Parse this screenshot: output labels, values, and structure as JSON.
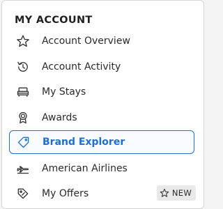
{
  "menu": {
    "title": "MY ACCOUNT",
    "items": [
      {
        "label": "Account Overview",
        "icon": "star-icon"
      },
      {
        "label": "Account Activity",
        "icon": "history-icon"
      },
      {
        "label": "My Stays",
        "icon": "bed-icon"
      },
      {
        "label": "Awards",
        "icon": "award-icon"
      },
      {
        "label": "Brand Explorer",
        "icon": "tag-icon",
        "active": true
      },
      {
        "label": "American Airlines",
        "icon": "airplane-icon"
      },
      {
        "label": "My Offers",
        "icon": "offer-tag-icon",
        "badge": {
          "label": "NEW",
          "icon": "star-outline-icon"
        }
      }
    ]
  },
  "colors": {
    "accent": "#1f6fd1",
    "badge_bg": "#e9e9e9"
  }
}
